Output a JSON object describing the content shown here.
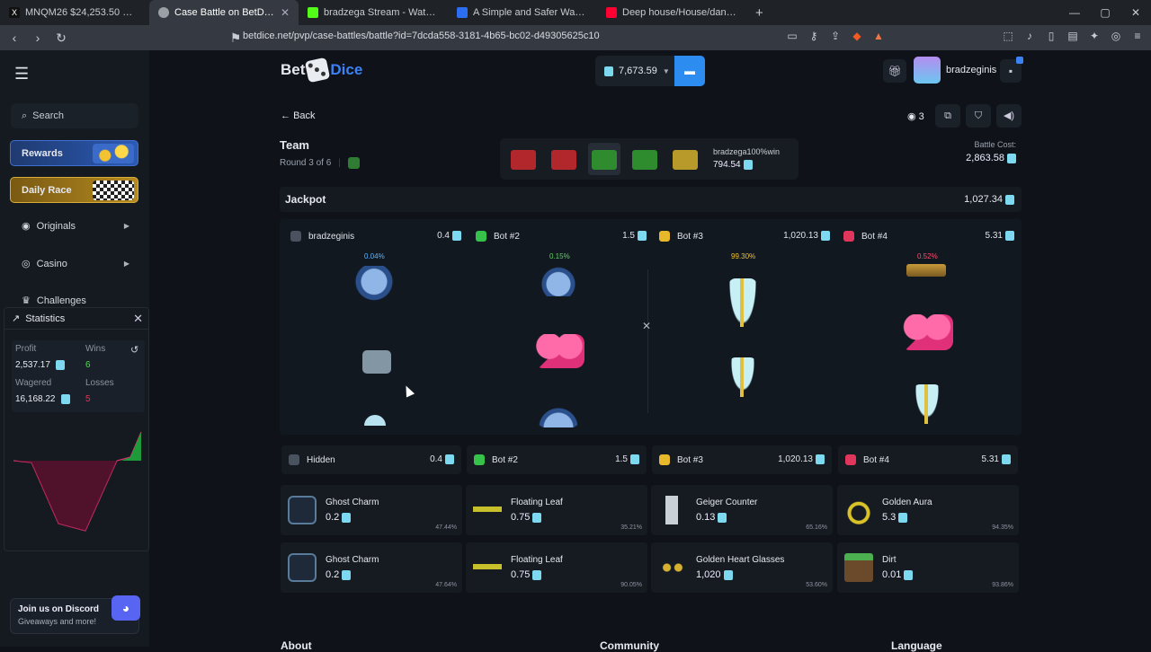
{
  "browser": {
    "tabs": [
      {
        "title": "MNQM26 $24,253.50 ▼ -1.33%",
        "color": "#ffffff"
      },
      {
        "title": "Case Battle on BetDice",
        "color": "#9aa0a6"
      },
      {
        "title": "bradzega Stream - Watch Live on Kick",
        "color": "#53fc18"
      },
      {
        "title": "A Simple and Safer Way to Pay and Get Paid",
        "color": "#2c6ef2"
      },
      {
        "title": "Deep house/House/dance - MK Mix",
        "color": "#ff0033"
      }
    ],
    "url": "betdice.net/pvp/case-battles/battle?id=7dcda558-3181-4b65-bc02-d49305625c10"
  },
  "sidebar": {
    "search_label": "Search",
    "rewards_label": "Rewards",
    "race_label": "Daily Race",
    "originals_label": "Originals",
    "casino_label": "Casino",
    "challenges_label": "Challenges"
  },
  "statistics": {
    "title": "Statistics",
    "profit_label": "Profit",
    "profit_value": "2,537.17",
    "wins_label": "Wins",
    "wins_value": "6",
    "wagered_label": "Wagered",
    "wagered_value": "16,168.22",
    "losses_label": "Losses",
    "losses_value": "5"
  },
  "discord": {
    "title": "Join us on Discord",
    "subtitle": "Giveaways and more!"
  },
  "header": {
    "logo_bet": "Bet",
    "logo_dice": "Dice",
    "balance": "7,673.59",
    "username": "bradzeginis"
  },
  "battle": {
    "back_label": "Back",
    "viewers": "3",
    "team_label": "Team",
    "round_label": "Round 3 of 6",
    "winner_name": "bradzega100%win",
    "winner_amount": "794.54",
    "cost_label": "Battle Cost:",
    "cost_value": "2,863.58",
    "jackpot_label": "Jackpot",
    "jackpot_value": "1,027.34",
    "cases": [
      {
        "color": "#b2272b"
      },
      {
        "color": "#b2272b"
      },
      {
        "color": "#2e8b2e"
      },
      {
        "color": "#2e8b2e"
      },
      {
        "color": "#b89a2a"
      }
    ]
  },
  "players": [
    {
      "name": "bradzeginis",
      "slot_name": "Hidden",
      "amount": "0.4",
      "chance": "0.04%",
      "icon_color": "#4a5260",
      "chance_color": "#5ab4ff"
    },
    {
      "name": "Bot #2",
      "slot_name": "Bot #2",
      "amount": "1.5",
      "chance": "0.15%",
      "icon_color": "#36c24a",
      "chance_color": "#5ad55a"
    },
    {
      "name": "Bot #3",
      "slot_name": "Bot #3",
      "amount": "1,020.13",
      "chance": "99.30%",
      "icon_color": "#e7b829",
      "chance_color": "#f2c230"
    },
    {
      "name": "Bot #4",
      "slot_name": "Bot #4",
      "amount": "5.31",
      "chance": "0.52%",
      "icon_color": "#e0365c",
      "chance_color": "#ff4d6d"
    }
  ],
  "drops": [
    [
      {
        "name": "Ghost Charm",
        "price": "0.2",
        "chance": "47.44%",
        "color": "#2a5d8a"
      },
      {
        "name": "Ghost Charm",
        "price": "0.2",
        "chance": "47.64%",
        "color": "#2a5d8a"
      }
    ],
    [
      {
        "name": "Floating Leaf",
        "price": "0.75",
        "chance": "35.21%",
        "color": "#c8c02a"
      },
      {
        "name": "Floating Leaf",
        "price": "0.75",
        "chance": "90.05%",
        "color": "#c8c02a"
      }
    ],
    [
      {
        "name": "Geiger Counter",
        "price": "0.13",
        "chance": "65.16%",
        "color": "#c9d1d6"
      },
      {
        "name": "Golden Heart Glasses",
        "price": "1,020",
        "chance": "53.60%",
        "color": "#d6b030"
      }
    ],
    [
      {
        "name": "Golden Aura",
        "price": "5.3",
        "chance": "94.35%",
        "color": "#d9c328"
      },
      {
        "name": "Dirt",
        "price": "0.01",
        "chance": "93.86%",
        "color": "#6a4a2a"
      }
    ]
  ],
  "footer": {
    "about": "About",
    "community": "Community",
    "language": "Language"
  }
}
